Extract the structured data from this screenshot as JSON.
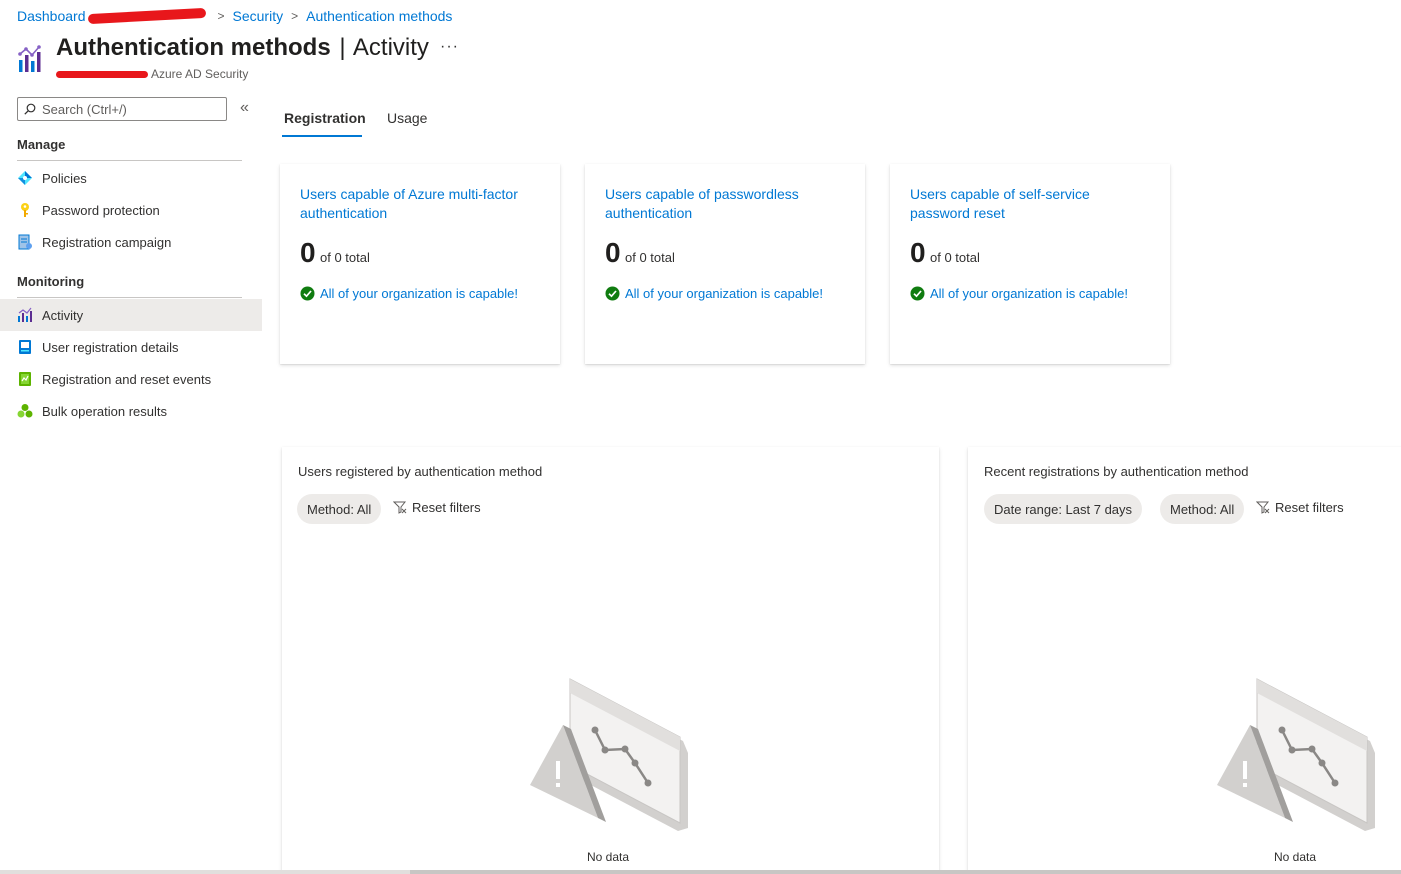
{
  "breadcrumb": {
    "items": [
      "Dashboard",
      "Security",
      "Authentication methods"
    ]
  },
  "header": {
    "title": "Authentication methods",
    "separator": "|",
    "subtitle_title": "Activity",
    "more_label": "···",
    "subtitle": "Azure AD Security"
  },
  "sidebar": {
    "search_placeholder": "Search (Ctrl+/)",
    "collapse_label": "«",
    "sections": [
      {
        "label": "Manage",
        "items": [
          {
            "label": "Policies",
            "icon": "policies-icon"
          },
          {
            "label": "Password protection",
            "icon": "key-icon"
          },
          {
            "label": "Registration campaign",
            "icon": "campaign-icon"
          }
        ]
      },
      {
        "label": "Monitoring",
        "items": [
          {
            "label": "Activity",
            "icon": "activity-chart-icon",
            "active": true
          },
          {
            "label": "User registration details",
            "icon": "user-details-icon"
          },
          {
            "label": "Registration and reset events",
            "icon": "events-icon"
          },
          {
            "label": "Bulk operation results",
            "icon": "bulk-results-icon"
          }
        ]
      }
    ]
  },
  "tabs": [
    {
      "label": "Registration",
      "active": true
    },
    {
      "label": "Usage",
      "active": false
    }
  ],
  "cards": [
    {
      "title": "Users capable of Azure multi-factor authentication",
      "count": "0",
      "of_total": "of 0 total",
      "status": "All of your organization is capable!"
    },
    {
      "title": "Users capable of passwordless authentication",
      "count": "0",
      "of_total": "of 0 total",
      "status": "All of your organization is capable!"
    },
    {
      "title": "Users capable of self-service password reset",
      "count": "0",
      "of_total": "of 0 total",
      "status": "All of your organization is capable!"
    }
  ],
  "panels": [
    {
      "title": "Users registered by authentication method",
      "filters": [
        "Method: All"
      ],
      "reset_label": "Reset filters",
      "empty_text": "No data"
    },
    {
      "title": "Recent registrations by authentication method",
      "filters": [
        "Date range: Last 7 days",
        "Method: All"
      ],
      "reset_label": "Reset filters",
      "empty_text": "No data"
    }
  ],
  "colors": {
    "accent": "#0078d4",
    "success": "#107c10",
    "active_bg": "#edebe9",
    "redaction": "#e8171b"
  }
}
